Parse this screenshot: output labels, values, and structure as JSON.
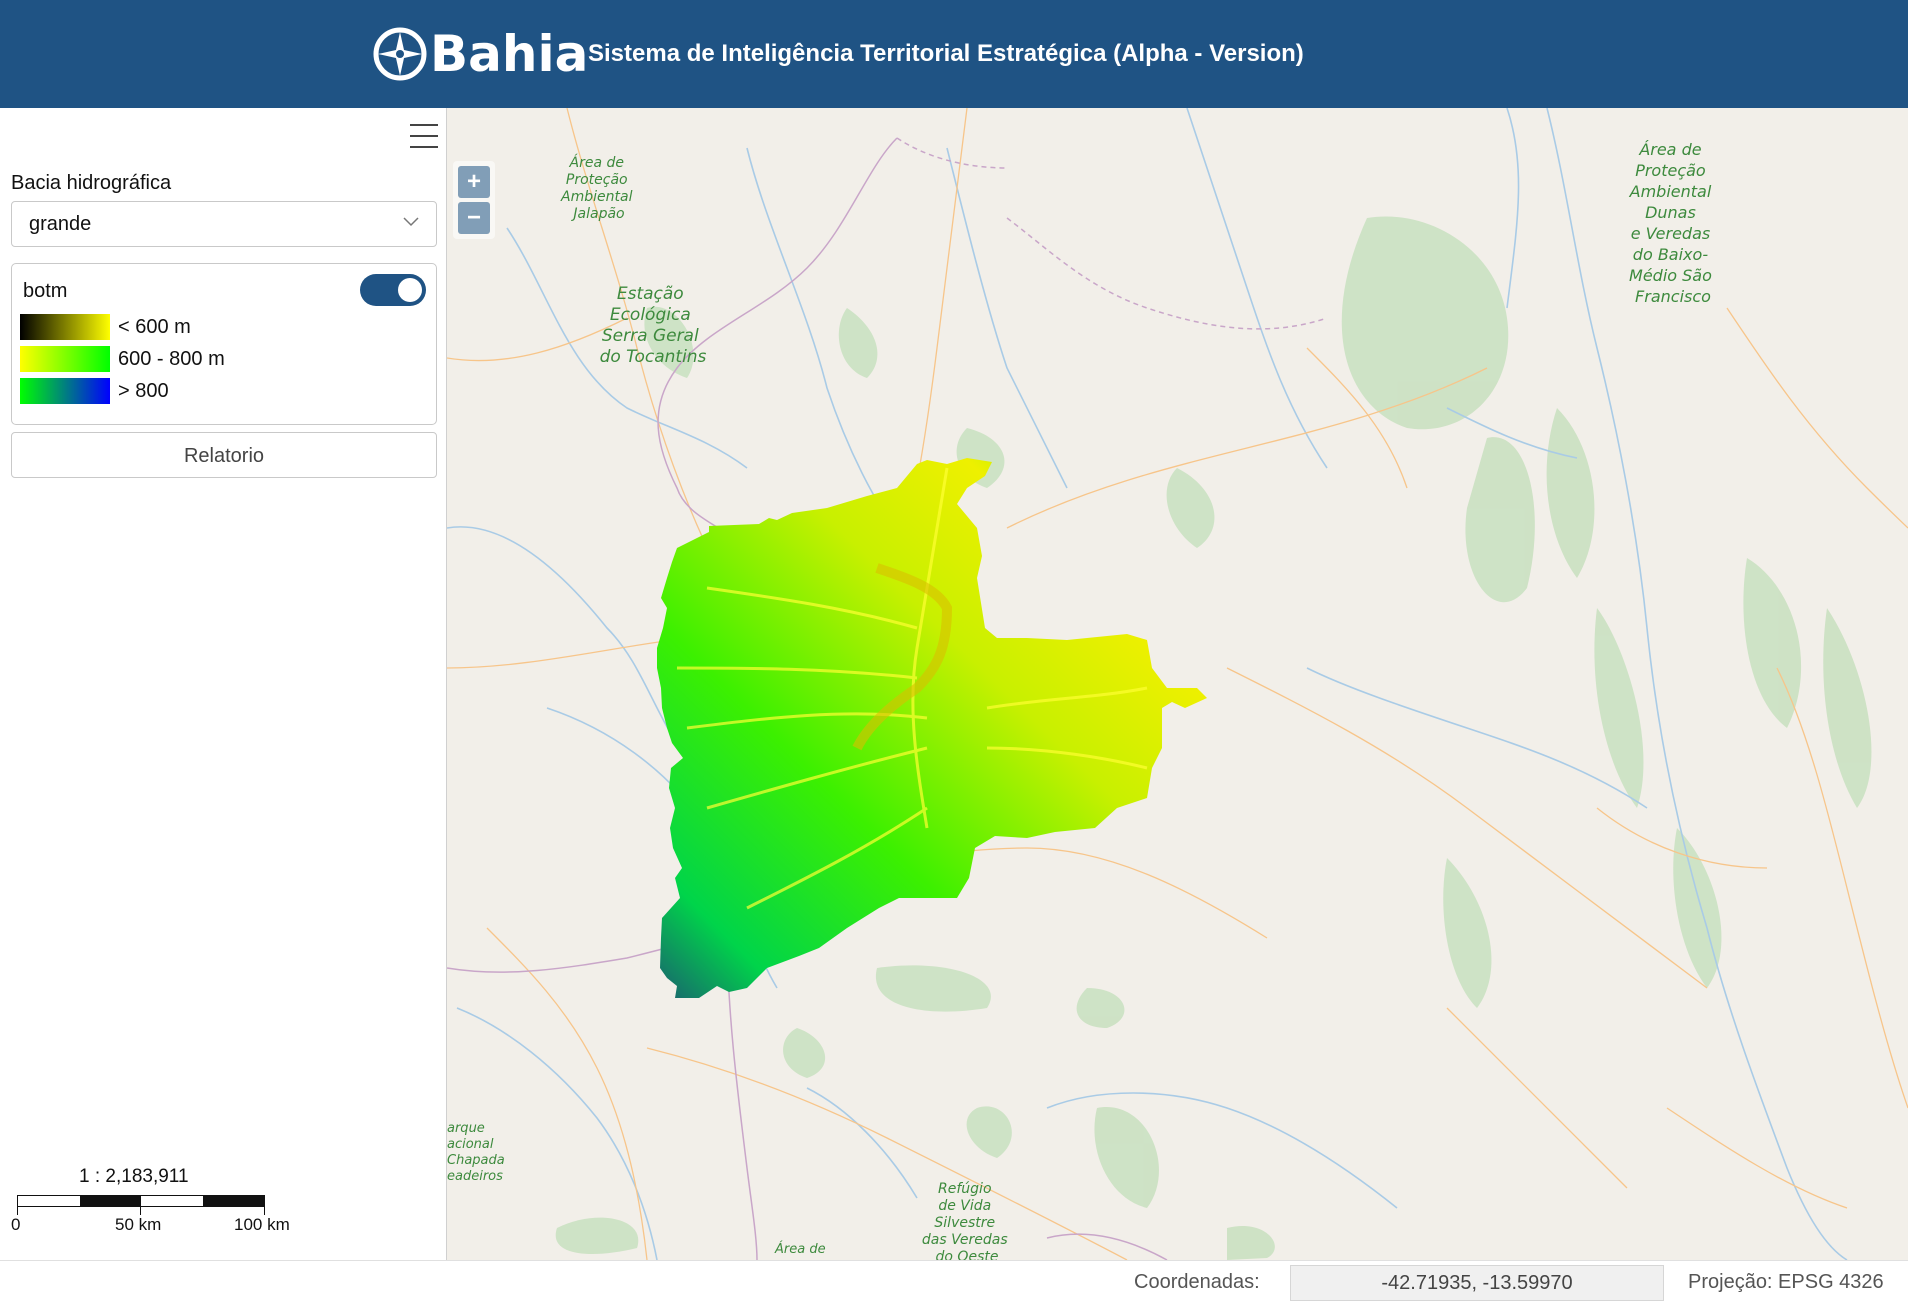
{
  "header": {
    "logo_text": "Bahia",
    "title": "Sistema de Inteligência Territorial Estratégica (Alpha - Version)",
    "background": "#1f5384"
  },
  "sidebar": {
    "menu_icon": "hamburger-menu-icon",
    "basin_label": "Bacia hidrográfica",
    "basin_value": "grande",
    "layer": {
      "name": "botm",
      "visible": true,
      "legend": [
        {
          "label": "< 600 m",
          "colors": [
            "#000000",
            "#ffff00"
          ]
        },
        {
          "label": "600 - 800 m",
          "colors": [
            "#ffff00",
            "#00ff00"
          ]
        },
        {
          "label": "> 800",
          "colors": [
            "#00ff00",
            "#0000ff"
          ]
        }
      ]
    },
    "report_button": "Relatorio"
  },
  "map": {
    "zoom_in": "+",
    "zoom_out": "−",
    "scale": {
      "ratio": "1 : 2,183,911",
      "labels": [
        "0",
        "50 km",
        "100 km"
      ]
    },
    "place_labels": [
      {
        "lines": [
          "Área de",
          "Proteção",
          "Ambiental",
          "Jalapão"
        ]
      },
      {
        "lines": [
          "Estação",
          "Ecológica",
          "Serra Geral",
          "do Tocantins"
        ]
      },
      {
        "lines": [
          "Área de",
          "Proteção",
          "Ambiental",
          "Dunas",
          "e Veredas",
          "do Baixo-",
          "Médio São",
          "Francisco"
        ]
      },
      {
        "lines": [
          "arque",
          "acional",
          "Chapada",
          "eadeiros"
        ]
      },
      {
        "lines": [
          "Refúgio",
          "de Vida",
          "Silvestre",
          "das Veredas",
          "do Oeste"
        ]
      },
      {
        "lines": [
          "Área de"
        ]
      }
    ]
  },
  "footer": {
    "coordinates_label": "Coordenadas:",
    "coordinates_value": "-42.71935, -13.59970",
    "projection": "Projeção: EPSG 4326"
  }
}
